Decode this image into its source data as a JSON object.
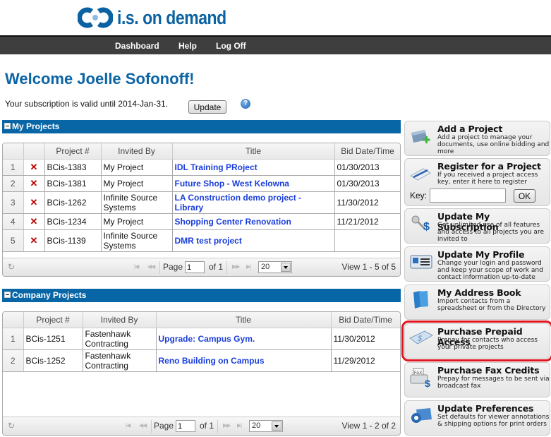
{
  "brand": {
    "name": "i.s. on demand",
    "color": "#0a62a2"
  },
  "nav": {
    "items": [
      "Dashboard",
      "Help",
      "Log Off"
    ]
  },
  "welcome": "Welcome Joelle Sofonoff!",
  "subscription": {
    "text": "Your subscription is valid until 2014-Jan-31.",
    "update_label": "Update",
    "help_icon": "help-icon"
  },
  "my_projects": {
    "title": "My Projects",
    "columns": [
      "",
      "",
      "Project #",
      "Invited By",
      "Title",
      "Bid Date/Time"
    ],
    "rows": [
      {
        "n": "1",
        "project": "BCis-1383",
        "invited_by": "My Project",
        "title": "IDL Training PRoject",
        "bid": "01/30/2013"
      },
      {
        "n": "2",
        "project": "BCis-1381",
        "invited_by": "My Project",
        "title": "Future Shop - West Kelowna",
        "bid": "01/30/2013"
      },
      {
        "n": "3",
        "project": "BCis-1262",
        "invited_by": "Infinite Source Systems",
        "title": "LA Construction demo project - Library",
        "bid": "11/30/2012"
      },
      {
        "n": "4",
        "project": "BCis-1234",
        "invited_by": "My Project",
        "title": "Shopping Center Renovation",
        "bid": "11/21/2012"
      },
      {
        "n": "5",
        "project": "BCis-1139",
        "invited_by": "Infinite Source Systems",
        "title": "DMR test project",
        "bid": ""
      }
    ],
    "delete_glyph": "✕",
    "pager": {
      "page_label": "Page",
      "page": "1",
      "of_label": "of 1",
      "page_size": "20",
      "view": "View 1 - 5 of 5"
    }
  },
  "company_projects": {
    "title": "Company Projects",
    "columns": [
      "",
      "Project #",
      "Invited By",
      "Title",
      "Bid Date/Time"
    ],
    "rows": [
      {
        "n": "1",
        "project": "BCis-1251",
        "invited_by": "Fastenhawk Contracting",
        "title": "Upgrade: Campus Gym.",
        "bid": "11/30/2012"
      },
      {
        "n": "2",
        "project": "BCis-1252",
        "invited_by": "Fastenhawk Contracting",
        "title": "Reno Building on Campus",
        "bid": "11/29/2012"
      }
    ],
    "pager": {
      "page_label": "Page",
      "page": "1",
      "of_label": "of 1",
      "page_size": "20",
      "view": "View 1 - 2 of 2"
    }
  },
  "sidebar": {
    "cards": [
      {
        "title": "Add a Project",
        "desc": "Add a project to manage your documents, use online bidding and more",
        "icon": "add-project-icon"
      },
      {
        "title": "Register for a Project",
        "desc": "If you received a project access key, enter it here to register",
        "icon": "register-icon",
        "key_label": "Key:",
        "key_value": "",
        "ok_label": "OK"
      },
      {
        "title": "Update My Subscription",
        "desc": "Get unlimited use of all features and access to all projects you are invited to",
        "icon": "key-dollar-icon"
      },
      {
        "title": "Update My Profile",
        "desc": "Change your login and password and keep your scope of work and contact information up-to-date",
        "icon": "profile-card-icon"
      },
      {
        "title": "My Address Book",
        "desc": "Import contacts from a spreadsheet or from the Directory",
        "icon": "address-book-icon"
      },
      {
        "title": "Purchase Prepaid Access",
        "desc": "Prepay for contacts who access your private projects",
        "icon": "prepaid-ticket-icon",
        "highlighted": true
      },
      {
        "title": "Purchase Fax Credits",
        "desc": "Prepay for messages to be sent via broadcast fax",
        "icon": "fax-dollar-icon"
      },
      {
        "title": "Update Preferences",
        "desc": "Set defaults for viewer annotations & shipping options for print orders",
        "icon": "preferences-gear-icon"
      }
    ],
    "highlight_color": "#e0141e"
  }
}
